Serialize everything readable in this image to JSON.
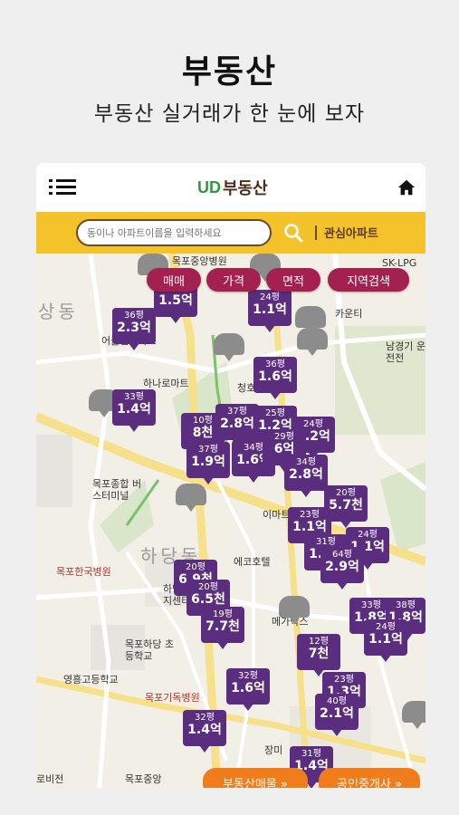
{
  "hero": {
    "title": "부동산",
    "subtitle": "부동산 실거래가 한 눈에 보자"
  },
  "appbar": {
    "logo_mark": "UD",
    "logo_text": "부동산"
  },
  "search": {
    "placeholder": "동이나 아파트이름을 입력하세요",
    "favorites_label": "관심아파트"
  },
  "filters": [
    "매매",
    "가격",
    "면적",
    "지역검색"
  ],
  "map_labels": [
    "상동",
    "목포중앙병원",
    "어울림아파트",
    "하나로마트",
    "청호",
    "목포한국병원",
    "하당동",
    "하당동 행정복지센터",
    "에코호텔",
    "메가박스",
    "목포하당 초등학교",
    "영흥고등학교",
    "목포기독병원",
    "목포종합 버스터미널",
    "목포중앙",
    "남경기 운전전",
    "SK-LPG",
    "이마트",
    "장미",
    "로비전",
    "카운티"
  ],
  "pins": [
    {
      "size": "36평",
      "price": "2.3억"
    },
    {
      "size": "33평",
      "price": "1.5억"
    },
    {
      "size": "24평",
      "price": "1.1억"
    },
    {
      "size": "36평",
      "price": "1.6억"
    },
    {
      "size": "33평",
      "price": "1.4억"
    },
    {
      "size": "10평",
      "price": "8천"
    },
    {
      "size": "37평",
      "price": "2.8억"
    },
    {
      "size": "25평",
      "price": "1.2억"
    },
    {
      "size": "24평",
      "price": "2.2억"
    },
    {
      "size": "37평",
      "price": "1.9억"
    },
    {
      "size": "34평",
      "price": "1.6억"
    },
    {
      "size": "29평",
      "price": "6억"
    },
    {
      "size": "34평",
      "price": "2.8억"
    },
    {
      "size": "20평",
      "price": "5.7천"
    },
    {
      "size": "23평",
      "price": "1.1억"
    },
    {
      "size": "24평",
      "price": "1.1억"
    },
    {
      "size": "31평",
      "price": "1.5억"
    },
    {
      "size": "64평",
      "price": "2.9억"
    },
    {
      "size": "20평",
      "price": "6.9천"
    },
    {
      "size": "20평",
      "price": "6.5천"
    },
    {
      "size": "19평",
      "price": "7.7천"
    },
    {
      "size": "33평",
      "price": "1.8억"
    },
    {
      "size": "38평",
      "price": "1.8억"
    },
    {
      "size": "24평",
      "price": "1.1억"
    },
    {
      "size": "12평",
      "price": "7천"
    },
    {
      "size": "32평",
      "price": "1.6억"
    },
    {
      "size": "23평",
      "price": "1.3억"
    },
    {
      "size": "40평",
      "price": "2.1억"
    },
    {
      "size": "32평",
      "price": "1.4억"
    },
    {
      "size": "31평",
      "price": "1.4억"
    }
  ],
  "bottom": {
    "listings_label": "부동산매물 »",
    "agents_label": "공인중개사 »"
  },
  "colors": {
    "accent_yellow": "#f4c22b",
    "pin_purple": "#5b2d7f",
    "chip_magenta": "#a3204f",
    "bottom_orange": "#f07c1c"
  }
}
